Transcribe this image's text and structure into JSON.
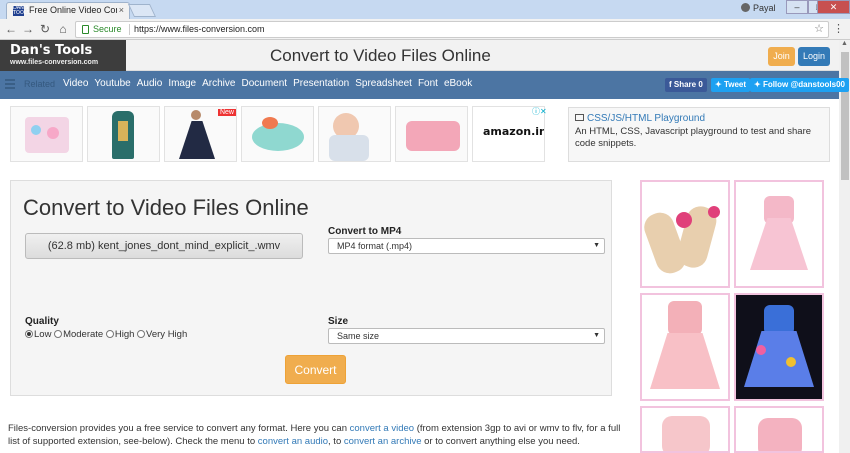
{
  "browser": {
    "tab_title": "Free Online Video Conve",
    "tab_close": "×",
    "favicon_text": "DAN'S TOOLS",
    "user_name": "Payal",
    "win_min": "–",
    "win_max": "□",
    "win_close": "✕",
    "secure_label": "Secure",
    "url": "https://www.files-conversion.com",
    "back": "←",
    "forward": "→",
    "reload": "↻",
    "home": "⌂",
    "star": "☆",
    "menu": "⋮"
  },
  "site": {
    "logo_name": "Dan's Tools",
    "logo_url": "www.files-conversion.com",
    "title": "Convert to Video Files Online",
    "join_label": "Join",
    "login_label": "Login"
  },
  "nav": {
    "related": "Related",
    "links": [
      "Video",
      "Youtube",
      "Audio",
      "Image",
      "Archive",
      "Document",
      "Presentation",
      "Spreadsheet",
      "Font",
      "eBook"
    ],
    "share_label": "f Share 0",
    "tweet_label": "Tweet",
    "follow_label": "Follow @danstools00"
  },
  "ads": {
    "new_badge": "New",
    "amazon_text": "amazon.in",
    "adchoice": "ⓘ✕"
  },
  "side_card": {
    "title": "CSS/JS/HTML Playground",
    "description": "An HTML, CSS, Javascript playground to test and share code snippets."
  },
  "converter": {
    "title": "Convert to Video Files Online",
    "file_label": "(62.8 mb) kent_jones_dont_mind_explicit_.wmv",
    "convert_to_label": "Convert to MP4",
    "format_value": "MP4 format (.mp4)",
    "quality_label": "Quality",
    "quality_options": [
      "Low",
      "Moderate",
      "High",
      "Very High"
    ],
    "quality_selected": "Low",
    "size_label": "Size",
    "size_value": "Same size",
    "convert_button": "Convert"
  },
  "footer": {
    "p1": "Files-conversion provides you a free service to convert any format. Here you can ",
    "link1": "convert a video",
    "p2": " (from extension 3gp to avi or wmv to flv, for a full list of supported extension, see-below). Check the menu to ",
    "link2": "convert an audio",
    "p3": ", to ",
    "link3": "convert an archive",
    "p4": " or to convert anything else you need."
  }
}
